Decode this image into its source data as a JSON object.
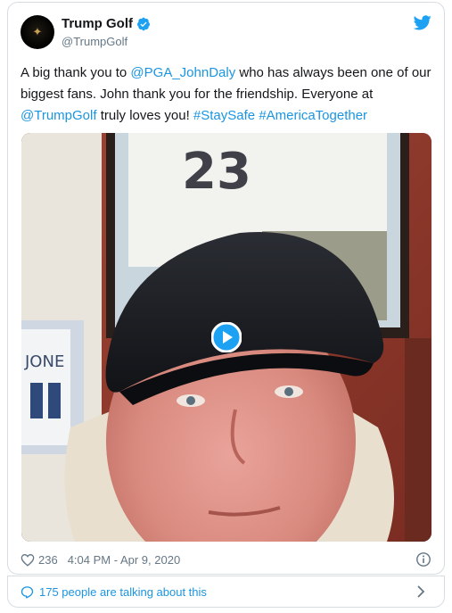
{
  "author": {
    "display_name": "Trump Golf",
    "handle": "@TrumpGolf",
    "verified": true
  },
  "tweet": {
    "text_1": "A big thank you to ",
    "mention_1": "@PGA_JohnDaly",
    "text_2": " who has always been one of our biggest fans. John thank you for the friendship. Everyone at ",
    "mention_2": "@TrumpGolf",
    "text_3": " truly loves you! ",
    "hashtag_1": "#StaySafe",
    "text_4": " ",
    "hashtag_2": "#AmericaTogether"
  },
  "media": {
    "jersey_number": "23",
    "jersey_text_left": "JONE"
  },
  "footer": {
    "like_count": "236",
    "timestamp": "4:04 PM - Apr 9, 2020",
    "conversation_link": "175 people are talking about this"
  },
  "colors": {
    "link": "#1b95e0",
    "verified": "#1da1f2",
    "text": "#14171a",
    "muted": "#657786"
  },
  "icons": {
    "logo": "twitter-bird-icon",
    "verified": "verified-badge-icon",
    "like": "heart-icon",
    "info": "info-icon",
    "conversation": "speech-bubble-icon",
    "more": "chevron-right-icon",
    "play": "play-icon"
  }
}
